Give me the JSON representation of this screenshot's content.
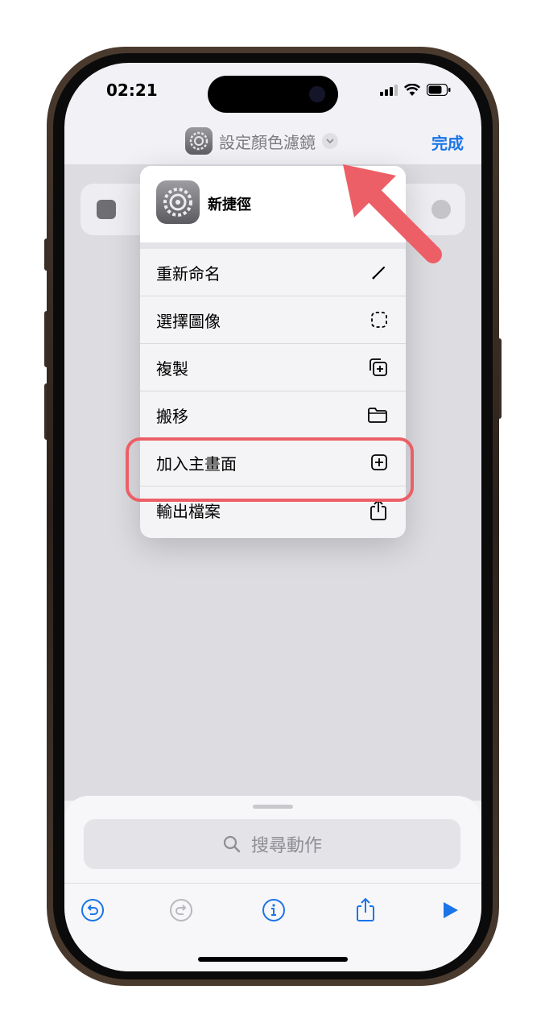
{
  "status_bar": {
    "time": "02:21"
  },
  "nav": {
    "title": "設定顏色濾鏡",
    "done_label": "完成"
  },
  "menu": {
    "shortcut_name": "新捷徑",
    "items": [
      {
        "label": "重新命名",
        "icon": "pencil-icon"
      },
      {
        "label": "選擇圖像",
        "icon": "dashed-square-icon"
      },
      {
        "label": "複製",
        "icon": "duplicate-icon"
      },
      {
        "label": "搬移",
        "icon": "folder-icon"
      },
      {
        "label": "加入主畫面",
        "icon": "plus-square-icon"
      },
      {
        "label": "輸出檔案",
        "icon": "share-icon"
      }
    ]
  },
  "search": {
    "placeholder": "搜尋動作"
  },
  "colors": {
    "accent": "#1a75e8",
    "highlight": "#ec5f66"
  }
}
